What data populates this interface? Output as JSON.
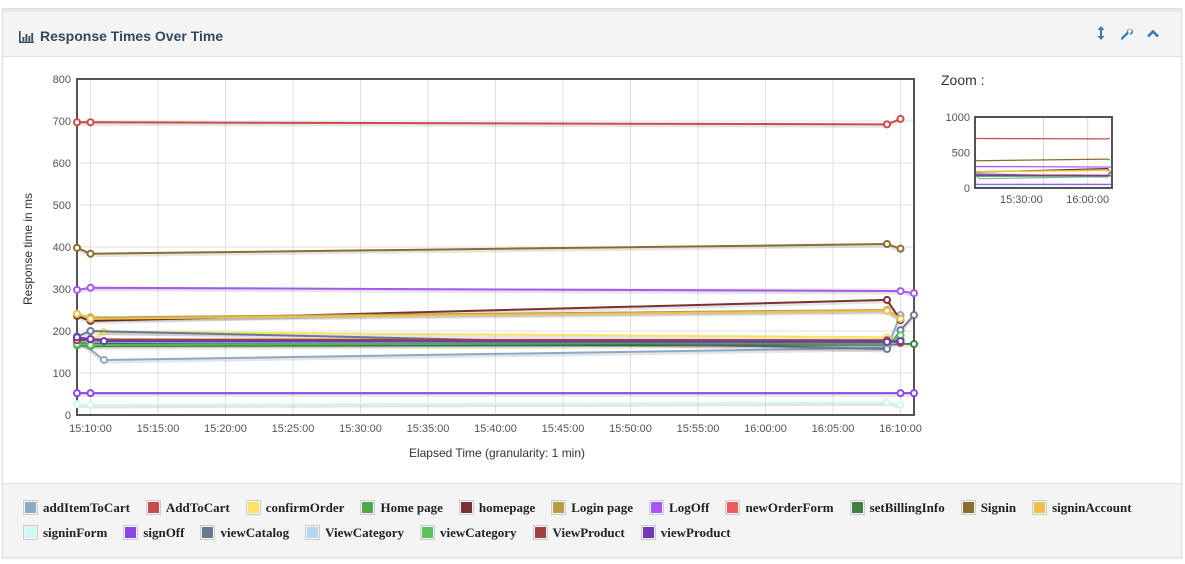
{
  "panel": {
    "title": "Response Times Over Time",
    "title_icon": "bar-chart-icon",
    "tools": [
      {
        "name": "resize-icon",
        "glyph": "↕"
      },
      {
        "name": "wrench-icon",
        "glyph": "wrench"
      },
      {
        "name": "collapse-chevron-up-icon",
        "glyph": "^"
      }
    ]
  },
  "zoom": {
    "label": "Zoom :",
    "y_ticks": [
      "0",
      "500",
      "1000"
    ],
    "x_ticks": [
      "15:30:00",
      "16:00:00"
    ],
    "ylim": [
      0,
      1000
    ]
  },
  "chart_data": {
    "type": "line",
    "title": "Response Times Over Time",
    "xlabel": "Elapsed Time (granularity: 1 min)",
    "ylabel": "Response time in ms",
    "ylim": [
      0,
      800
    ],
    "xlim_minutes": [
      -1.0,
      61.0
    ],
    "x_reference": "15:10:00",
    "y_ticks": [
      0,
      100,
      200,
      300,
      400,
      500,
      600,
      700,
      800
    ],
    "x_ticks": [
      "15:10:00",
      "15:15:00",
      "15:20:00",
      "15:25:00",
      "15:30:00",
      "15:35:00",
      "15:40:00",
      "15:45:00",
      "15:50:00",
      "15:55:00",
      "16:00:00",
      "16:05:00",
      "16:10:00"
    ],
    "grid": true,
    "legend_position": "bottom",
    "series": [
      {
        "name": "addItemToCart",
        "color": "#8fa9c2",
        "points": [
          [
            -1,
            181
          ],
          [
            1,
            131
          ],
          [
            59,
            160
          ],
          [
            60,
            238
          ]
        ]
      },
      {
        "name": "AddToCart",
        "color": "#cb4b4b",
        "points": [
          [
            -1,
            697
          ],
          [
            0,
            697
          ],
          [
            59,
            692
          ],
          [
            60,
            705
          ]
        ]
      },
      {
        "name": "confirmOrder",
        "color": "#ffe360",
        "points": [
          [
            0,
            178
          ],
          [
            1,
            198
          ],
          [
            59,
            185
          ],
          [
            60,
            175
          ]
        ]
      },
      {
        "name": "Home page",
        "color": "#4da74d",
        "points": [
          [
            -1,
            166
          ],
          [
            0,
            164
          ],
          [
            59,
            168
          ],
          [
            60,
            180
          ]
        ]
      },
      {
        "name": "homepage",
        "color": "#783232",
        "points": [
          [
            -1,
            236
          ],
          [
            0,
            224
          ],
          [
            59,
            274
          ],
          [
            60,
            226
          ]
        ]
      },
      {
        "name": "Login page",
        "color": "#bb9a48",
        "points": [
          [
            -1,
            240
          ],
          [
            0,
            232
          ],
          [
            59,
            250
          ],
          [
            60,
            230
          ]
        ]
      },
      {
        "name": "LogOff",
        "color": "#a856f0",
        "points": [
          [
            -1,
            298
          ],
          [
            0,
            303
          ],
          [
            60,
            295
          ],
          [
            61,
            290
          ]
        ]
      },
      {
        "name": "newOrderForm",
        "color": "#f05a5a",
        "points": [
          [
            -1,
            180
          ],
          [
            0,
            178
          ],
          [
            59,
            176
          ],
          [
            60,
            174
          ]
        ]
      },
      {
        "name": "setBillingInfo",
        "color": "#3e8040",
        "points": [
          [
            -1,
            172
          ],
          [
            0,
            170
          ],
          [
            59,
            170
          ],
          [
            61,
            169
          ]
        ]
      },
      {
        "name": "Signin",
        "color": "#8a6d2e",
        "points": [
          [
            -1,
            398
          ],
          [
            0,
            384
          ],
          [
            59,
            407
          ],
          [
            60,
            396
          ]
        ]
      },
      {
        "name": "signinAccount",
        "color": "#ecc04a",
        "points": [
          [
            -1,
            241
          ],
          [
            0,
            229
          ],
          [
            59,
            248
          ],
          [
            60,
            229
          ]
        ]
      },
      {
        "name": "signinForm",
        "color": "#cdf8f8",
        "points": [
          [
            -1,
            26
          ],
          [
            0,
            24
          ],
          [
            59,
            30
          ],
          [
            60,
            24
          ]
        ]
      },
      {
        "name": "signOff",
        "color": "#8c45e8",
        "points": [
          [
            -1,
            52
          ],
          [
            0,
            52
          ],
          [
            60,
            52
          ],
          [
            61,
            52
          ]
        ]
      },
      {
        "name": "viewCatalog",
        "color": "#687a8e",
        "points": [
          [
            -1,
            187
          ],
          [
            0,
            200
          ],
          [
            59,
            157
          ],
          [
            60,
            202
          ],
          [
            61,
            238
          ]
        ]
      },
      {
        "name": "ViewCategory",
        "color": "#b4d8f4",
        "points": [
          [
            -1,
            176
          ],
          [
            0,
            174
          ],
          [
            59,
            170
          ],
          [
            60,
            172
          ]
        ]
      },
      {
        "name": "viewCategory",
        "color": "#5cc25c",
        "points": [
          [
            -1,
            169
          ],
          [
            0,
            167
          ],
          [
            59,
            172
          ],
          [
            60,
            190
          ]
        ]
      },
      {
        "name": "ViewProduct",
        "color": "#a04040",
        "points": [
          [
            -1,
            178
          ],
          [
            0,
            180
          ],
          [
            59,
            178
          ],
          [
            60,
            172
          ]
        ]
      },
      {
        "name": "viewProduct",
        "color": "#7039b8",
        "points": [
          [
            -1,
            185
          ],
          [
            0,
            181
          ],
          [
            1,
            176
          ],
          [
            59,
            174
          ],
          [
            60,
            176
          ]
        ]
      }
    ]
  }
}
